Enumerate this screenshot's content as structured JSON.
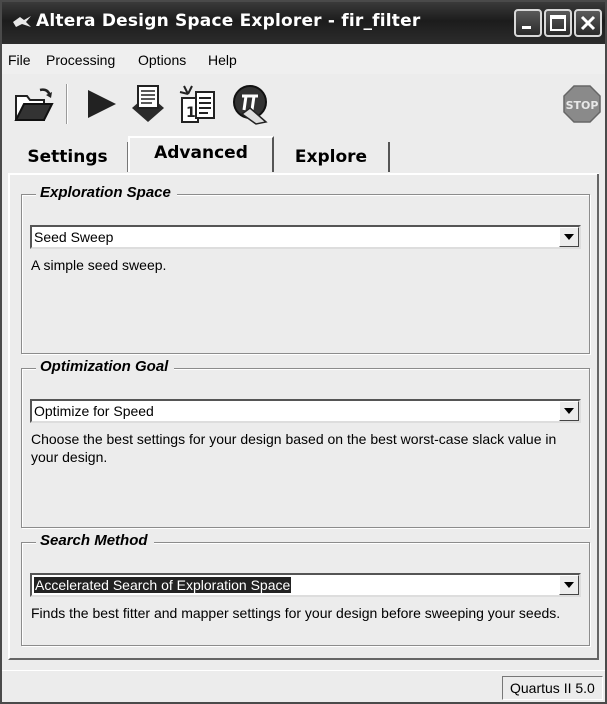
{
  "window": {
    "title": "Altera Design Space Explorer - fir_filter"
  },
  "menu": [
    {
      "label": "File"
    },
    {
      "label": "Processing"
    },
    {
      "label": "Options"
    },
    {
      "label": "Help"
    }
  ],
  "toolbar": {
    "stop_label": "STOP",
    "icons": [
      "open-folder-icon",
      "run-icon",
      "chip-icon",
      "report-icon",
      "quartus-icon",
      "stop-icon"
    ]
  },
  "tabs": [
    {
      "label": "Settings"
    },
    {
      "label": "Advanced",
      "active": true
    },
    {
      "label": "Explore"
    }
  ],
  "groups": {
    "exploration_space": {
      "legend": "Exploration Space",
      "value": "Seed Sweep",
      "description": "A simple seed sweep."
    },
    "optimization_goal": {
      "legend": "Optimization Goal",
      "value": "Optimize for Speed",
      "description": "Choose the best settings for your design based on the best worst-case slack value in your design."
    },
    "search_method": {
      "legend": "Search Method",
      "value": "Accelerated Search of Exploration Space",
      "description": "Finds the best fitter and mapper settings for your design before sweeping your seeds."
    }
  },
  "status": {
    "version": "Quartus II 5.0"
  },
  "colors": {
    "titlebar": "#2a2a2a",
    "window_bg": "#ececec",
    "selection": "#222222"
  }
}
